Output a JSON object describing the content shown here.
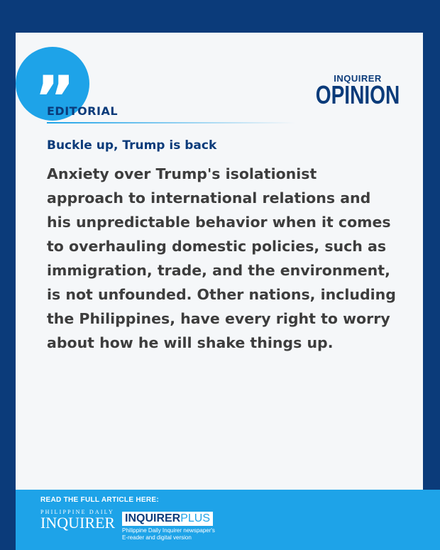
{
  "brand": {
    "top": "INQUIRER",
    "main": "OPINION"
  },
  "quote_glyph": "”",
  "section_label": "EDITORIAL",
  "headline": "Buckle up, Trump is back",
  "body": "Anxiety over Trump's isolationist approach to international relations and his unpredictable behavior when it comes to overhauling domestic policies, such as immigration, trade, and the environment, is not unfounded. Other nations, including the Philippines, have every right to worry about how he will shake things up.",
  "footer": {
    "cta": "READ THE FULL ARTICLE HERE:",
    "pdi_top": "PHILIPPINE DAILY",
    "pdi_main": "INQUIRER",
    "plus_logo_a": "INQUIRER",
    "plus_logo_b": "PLUS",
    "plus_desc_1": "Philippine Daily Inquirer newspaper's",
    "plus_desc_2": "E-reader and digital version"
  },
  "colors": {
    "navy": "#0b3b7a",
    "sky": "#1ea3e8",
    "card": "#f5f7f9",
    "body_text": "#3d3d3d"
  }
}
